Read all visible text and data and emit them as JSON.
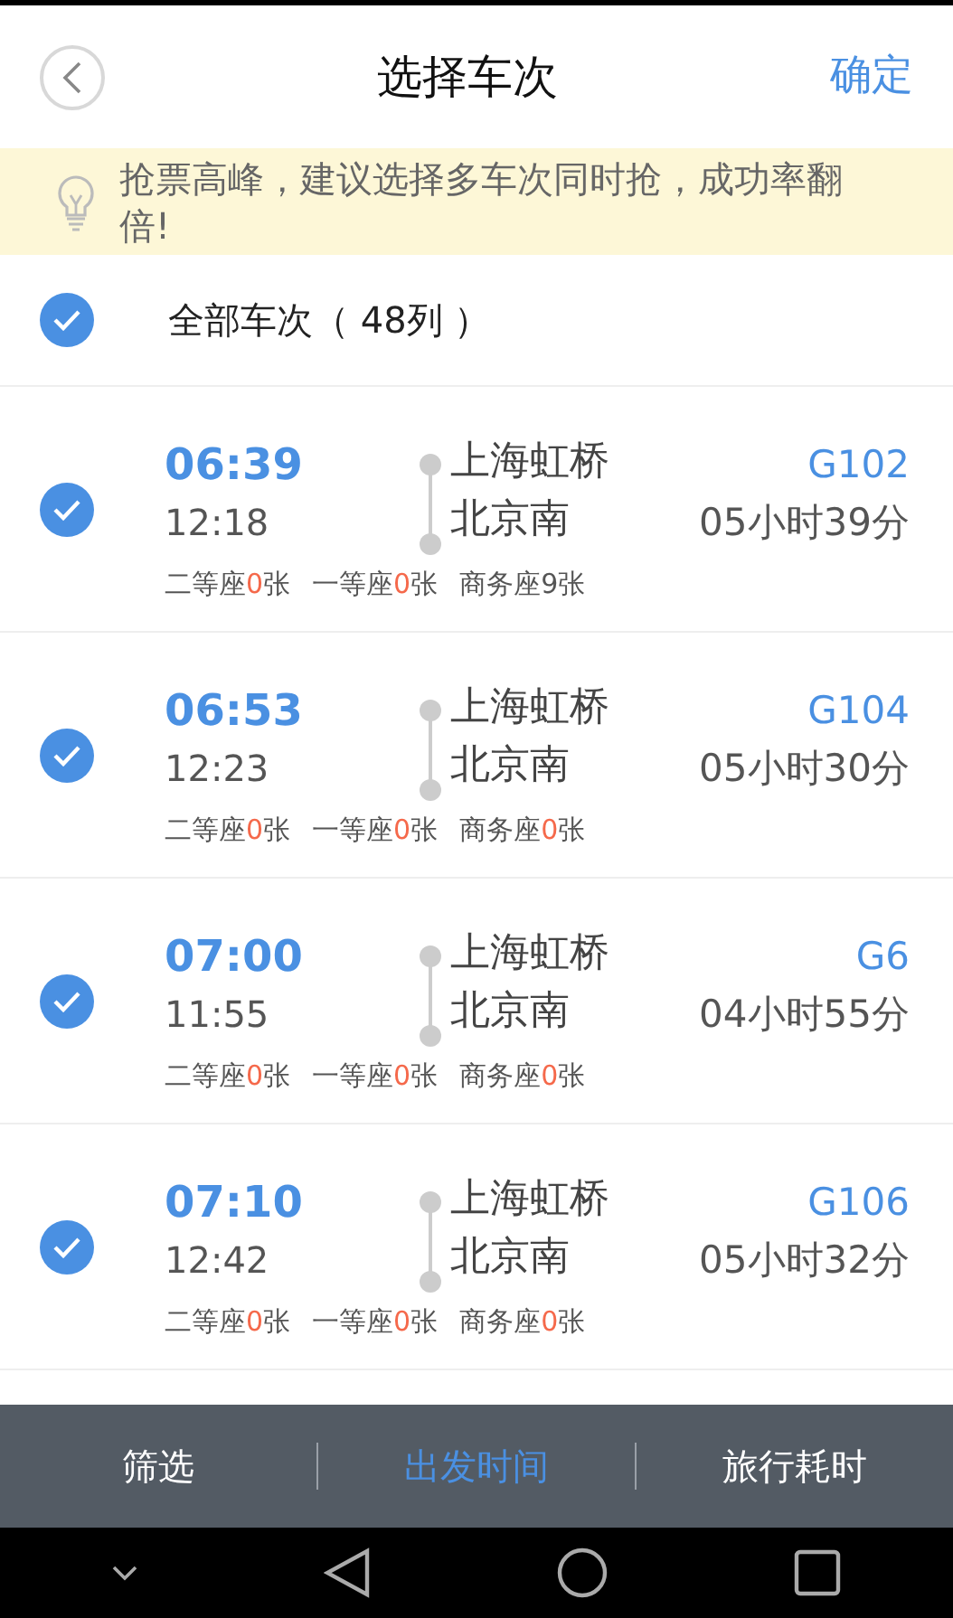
{
  "header": {
    "title": "选择车次",
    "confirm": "确定"
  },
  "tip": {
    "text": "抢票高峰，建议选择多车次同时抢，成功率翻倍!"
  },
  "select_all": {
    "label": "全部车次（ 48列 ）",
    "checked": true
  },
  "trains": [
    {
      "checked": true,
      "depart": "06:39",
      "arrive": "12:18",
      "from": "上海虹桥",
      "to": "北京南",
      "number": "G102",
      "duration": "05小时39分",
      "seats": [
        {
          "label": "二等座",
          "count": "0",
          "unit": "张",
          "sold_out": true
        },
        {
          "label": "一等座",
          "count": "0",
          "unit": "张",
          "sold_out": true
        },
        {
          "label": "商务座",
          "count": "9",
          "unit": "张",
          "sold_out": false
        }
      ]
    },
    {
      "checked": true,
      "depart": "06:53",
      "arrive": "12:23",
      "from": "上海虹桥",
      "to": "北京南",
      "number": "G104",
      "duration": "05小时30分",
      "seats": [
        {
          "label": "二等座",
          "count": "0",
          "unit": "张",
          "sold_out": true
        },
        {
          "label": "一等座",
          "count": "0",
          "unit": "张",
          "sold_out": true
        },
        {
          "label": "商务座",
          "count": "0",
          "unit": "张",
          "sold_out": true
        }
      ]
    },
    {
      "checked": true,
      "depart": "07:00",
      "arrive": "11:55",
      "from": "上海虹桥",
      "to": "北京南",
      "number": "G6",
      "duration": "04小时55分",
      "seats": [
        {
          "label": "二等座",
          "count": "0",
          "unit": "张",
          "sold_out": true
        },
        {
          "label": "一等座",
          "count": "0",
          "unit": "张",
          "sold_out": true
        },
        {
          "label": "商务座",
          "count": "0",
          "unit": "张",
          "sold_out": true
        }
      ]
    },
    {
      "checked": true,
      "depart": "07:10",
      "arrive": "12:42",
      "from": "上海虹桥",
      "to": "北京南",
      "number": "G106",
      "duration": "05小时32分",
      "seats": [
        {
          "label": "二等座",
          "count": "0",
          "unit": "张",
          "sold_out": true
        },
        {
          "label": "一等座",
          "count": "0",
          "unit": "张",
          "sold_out": true
        },
        {
          "label": "商务座",
          "count": "0",
          "unit": "张",
          "sold_out": true
        }
      ]
    }
  ],
  "sort_bar": [
    {
      "label": "筛选",
      "selected": false
    },
    {
      "label": "出发时间",
      "selected": true
    },
    {
      "label": "旅行耗时",
      "selected": false
    }
  ]
}
